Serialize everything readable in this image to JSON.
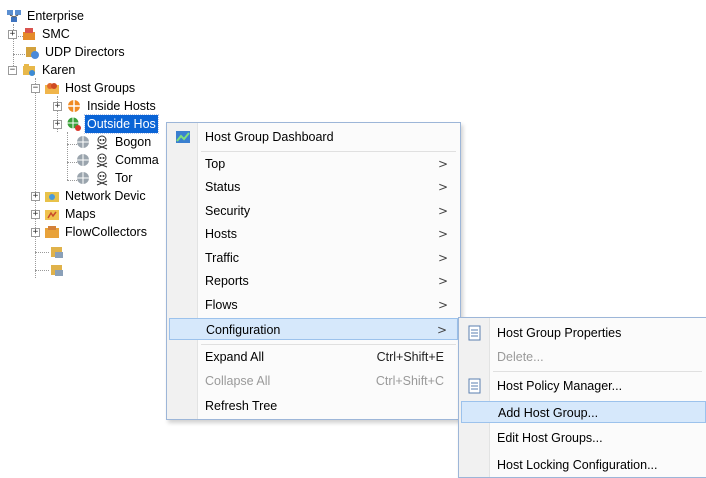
{
  "tree": {
    "enterprise": "Enterprise",
    "smc": "SMC",
    "udp": "UDP Directors",
    "karen": "Karen",
    "host_groups": "Host Groups",
    "inside_hosts": "Inside Hosts",
    "outside_hosts": "Outside Hos",
    "bogon": "Bogon",
    "command": "Comma",
    "tor": "Tor",
    "network_devices": "Network Devic",
    "maps": "Maps",
    "flowcollectors": "FlowCollectors"
  },
  "context_menu": {
    "dashboard": "Host Group Dashboard",
    "top": "Top",
    "status": "Status",
    "security": "Security",
    "hosts": "Hosts",
    "traffic": "Traffic",
    "reports": "Reports",
    "flows": "Flows",
    "configuration": "Configuration",
    "expand_all": "Expand All",
    "expand_all_shortcut": "Ctrl+Shift+E",
    "collapse_all": "Collapse All",
    "collapse_all_shortcut": "Ctrl+Shift+C",
    "refresh_tree": "Refresh Tree",
    "arrow": ">"
  },
  "submenu": {
    "properties": "Host Group Properties",
    "delete": "Delete...",
    "policy_manager": "Host Policy Manager...",
    "add_group": "Add Host Group...",
    "edit_groups": "Edit Host Groups...",
    "locking": "Host Locking Configuration..."
  },
  "colors": {
    "selection": "#0a64d6",
    "hover": "#d6e8fb",
    "hover_border": "#9cc2ec"
  }
}
